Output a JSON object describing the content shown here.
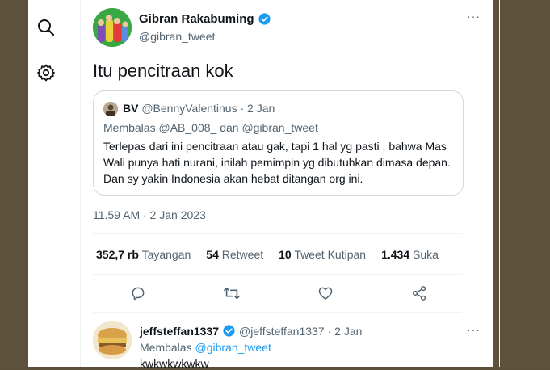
{
  "tweet": {
    "author_name": "Gibran Rakabuming",
    "author_handle": "@gibran_tweet",
    "more": "···",
    "text": "Itu pencitraan kok",
    "timestamp": "11.59 AM · 2 Jan 2023"
  },
  "quote": {
    "initials": "BV",
    "handle": "@BennyValentinus",
    "date": "· 2 Jan",
    "reply_prefix": "Membalas",
    "reply_mention_1": "@AB_008_",
    "reply_joiner": "dan",
    "reply_mention_2": "@gibran_tweet",
    "body": "Terlepas dari ini pencitraan atau gak, tapi 1 hal yg pasti , bahwa Mas Wali punya hati nurani, inilah pemimpin yg dibutuhkan dimasa depan. Dan sy yakin Indonesia akan hebat ditangan org ini."
  },
  "stats": [
    {
      "number": "352,7 rb",
      "label": "Tayangan"
    },
    {
      "number": "54",
      "label": "Retweet"
    },
    {
      "number": "10",
      "label": "Tweet Kutipan"
    },
    {
      "number": "1.434",
      "label": "Suka"
    }
  ],
  "actions": {
    "icons": [
      "reply-icon",
      "retweet-icon",
      "like-icon",
      "share-icon"
    ]
  },
  "reply": {
    "name": "jeffsteffan1337",
    "handle": "@jeffsteffan1337",
    "date": "· 2 Jan",
    "reply_prefix": "Membalas",
    "reply_mention": "@gibran_tweet",
    "text": "kwkwkwkwkw",
    "more": "···"
  },
  "colors": {
    "accent": "#1d9bf0",
    "secondary_text": "#536471",
    "primary_text": "#0f1419",
    "border": "#cfd9de"
  },
  "rail": {
    "icons": [
      "search-icon",
      "gear-icon"
    ]
  }
}
